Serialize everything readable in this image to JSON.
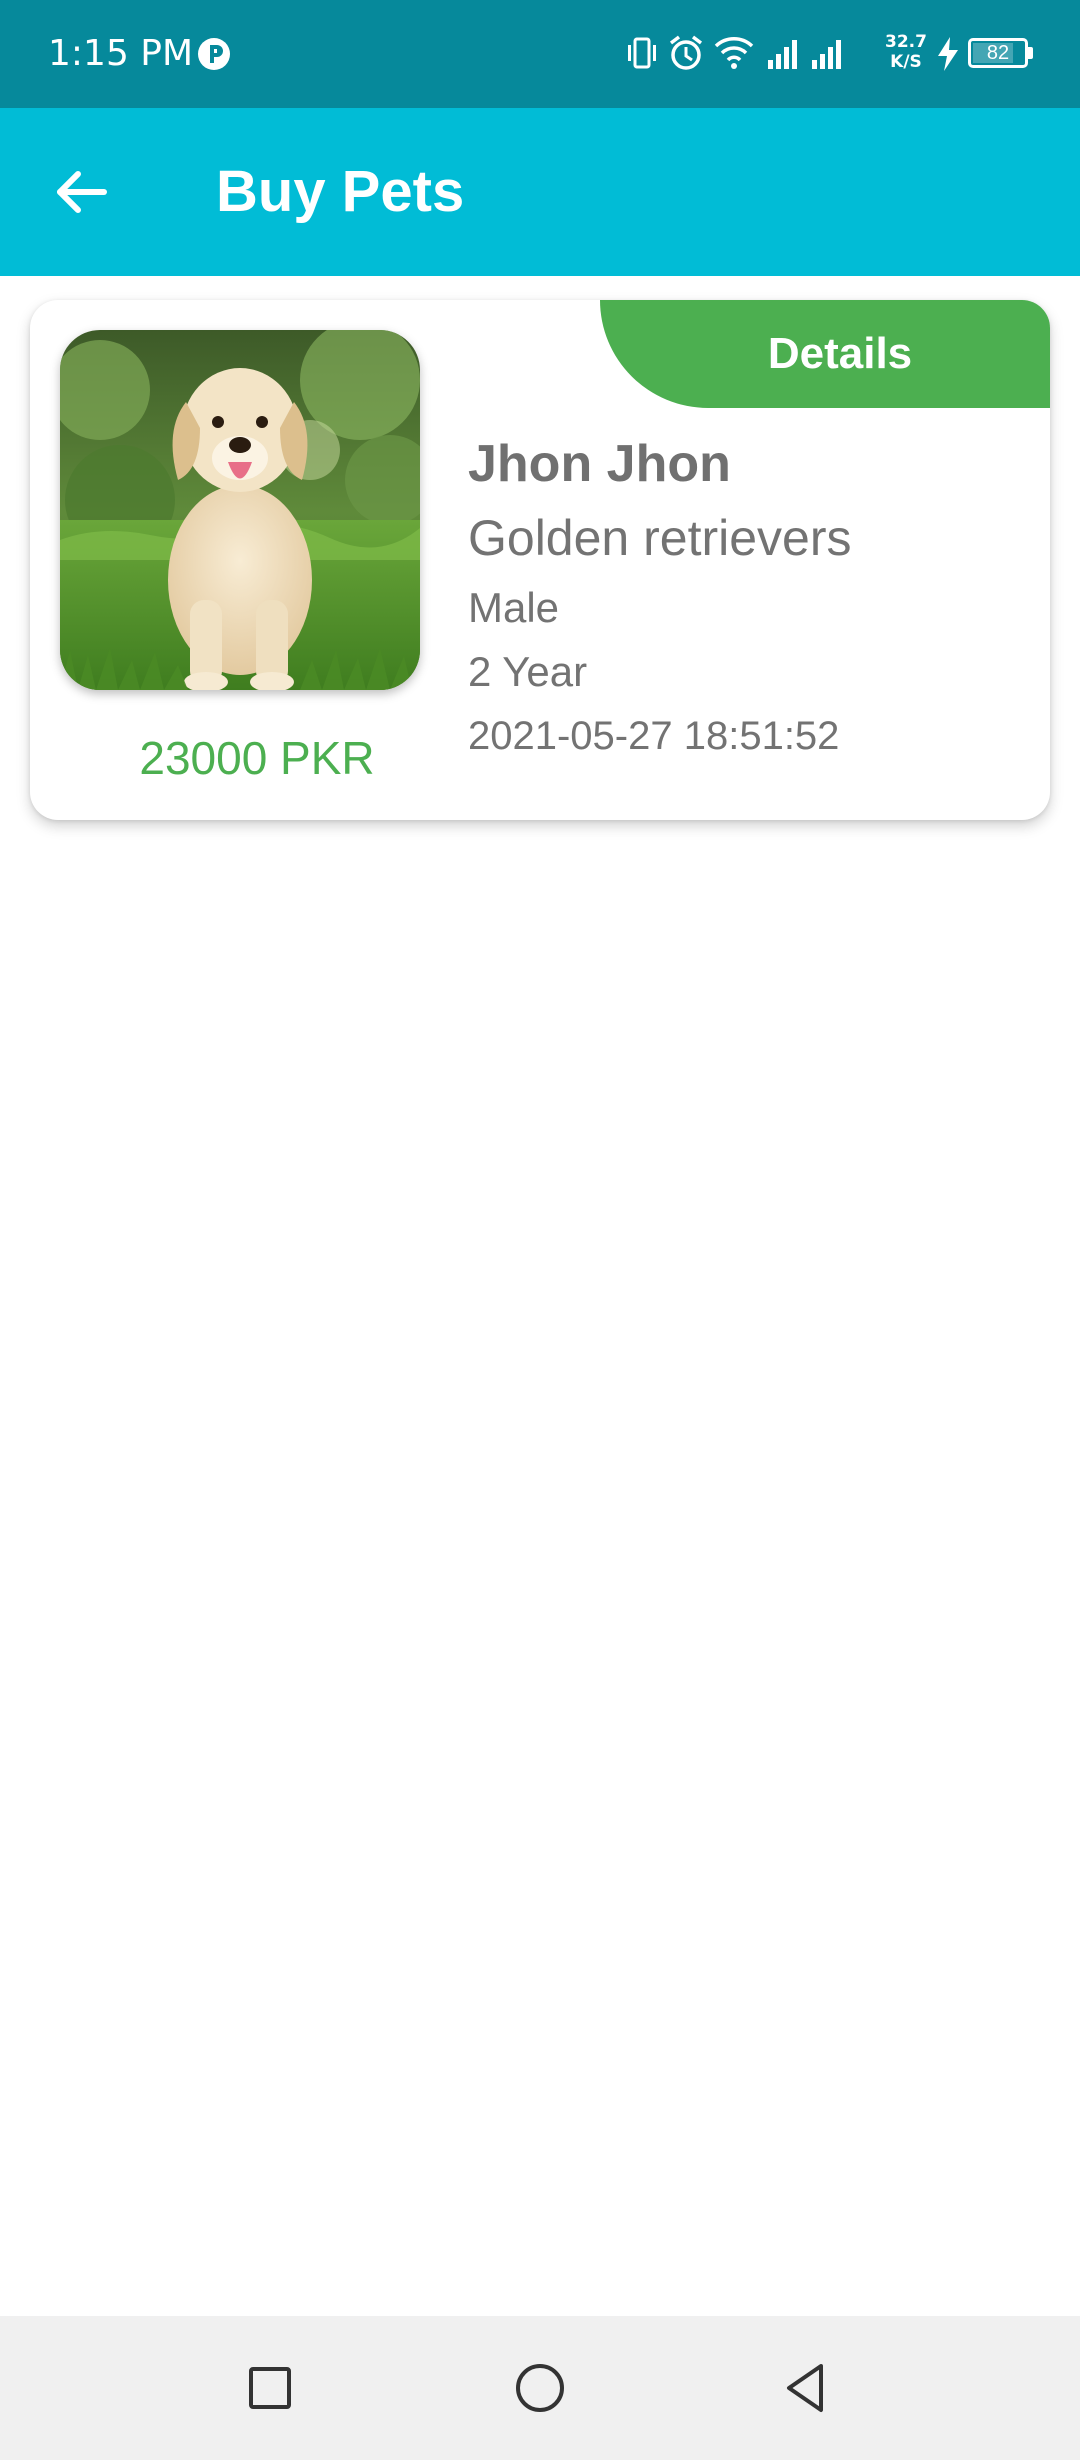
{
  "status_bar": {
    "time": "1:15 PM",
    "net_speed_value": "32.7",
    "net_speed_unit": "K/S",
    "battery_level": "82",
    "battery_fraction": 0.82,
    "icons": [
      "app-notification-icon",
      "vibrate-icon",
      "alarm-icon",
      "wifi-icon",
      "signal-icon",
      "signal-icon",
      "charging-icon",
      "battery-icon"
    ]
  },
  "app_bar": {
    "title": "Buy Pets",
    "back_icon": "arrow-left-icon"
  },
  "pets": [
    {
      "details_label": "Details",
      "name": "Jhon Jhon",
      "breed": "Golden retrievers",
      "gender": "Male",
      "age": "2 Year",
      "date": "2021-05-27 18:51:52",
      "price": "23000 PKR"
    }
  ],
  "colors": {
    "status_bar": "#06899b",
    "app_bar": "#01bcd6",
    "accent_green": "#4caf50",
    "text_gray": "#737373",
    "nav_bar": "#f0f0f0"
  },
  "nav_bar": {
    "icons": [
      "recents-square-icon",
      "home-circle-icon",
      "back-triangle-icon"
    ]
  }
}
